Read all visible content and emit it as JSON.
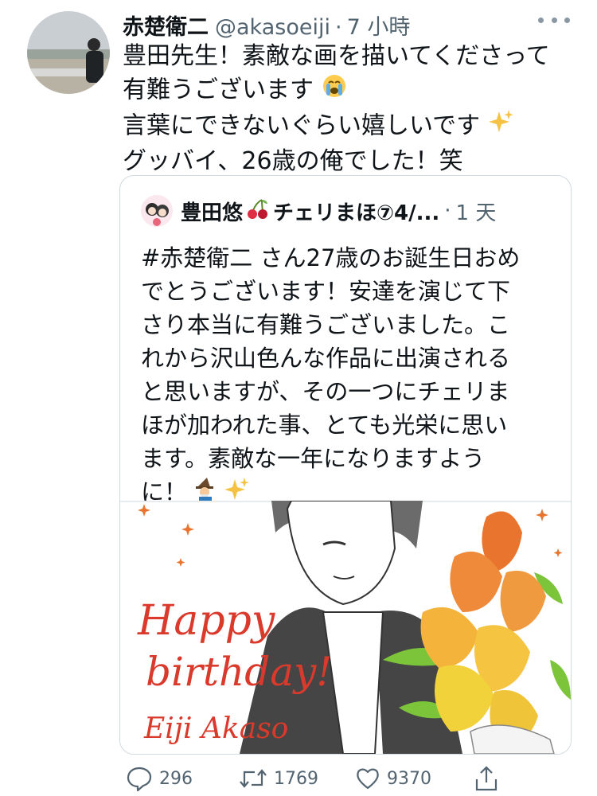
{
  "tweet": {
    "author_name": "赤楚衛二",
    "handle": "@akasoeiji",
    "separator": "·",
    "time": "7 小時",
    "lines": [
      "豊田先生！素敵な画を描いてくださって",
      "有難うございます",
      "言葉にできないぐらい嬉しいです",
      "グッバイ、26歳の俺でした！笑"
    ],
    "line2_emoji": "crying-face-emoji",
    "line3_emoji": "sparkles-emoji"
  },
  "quote": {
    "author_name": "豊田悠",
    "author_suffix": "チェリまほ⑦4/...",
    "name_emoji": "cherries-emoji",
    "separator": "·",
    "time": "1 天",
    "lines": [
      "#赤楚衛二 さん27歳のお誕生日おめ",
      "でとうございます！安達を演じて下",
      "さり本当に有難うございました。こ",
      "れから沢山色んな作品に出演される",
      "と思いますが、その一つにチェリま",
      "ほが加われた事、とても光栄に思い",
      "ます。素敵な一年になりますよう",
      "に！"
    ],
    "end_emojis": [
      "mage-emoji",
      "sparkles-emoji"
    ],
    "image": {
      "text_line1": "Happy",
      "text_line2": "birthday!",
      "text_line3": "Eiji Akaso"
    }
  },
  "actions": {
    "reply_count": "296",
    "retweet_count": "1769",
    "like_count": "9370"
  },
  "colors": {
    "secondary_text": "#536471",
    "border": "#cfd9de",
    "handwriting_red": "#d93a2b",
    "flower_orange": "#e8742e",
    "leaf_green": "#7cc43a"
  }
}
